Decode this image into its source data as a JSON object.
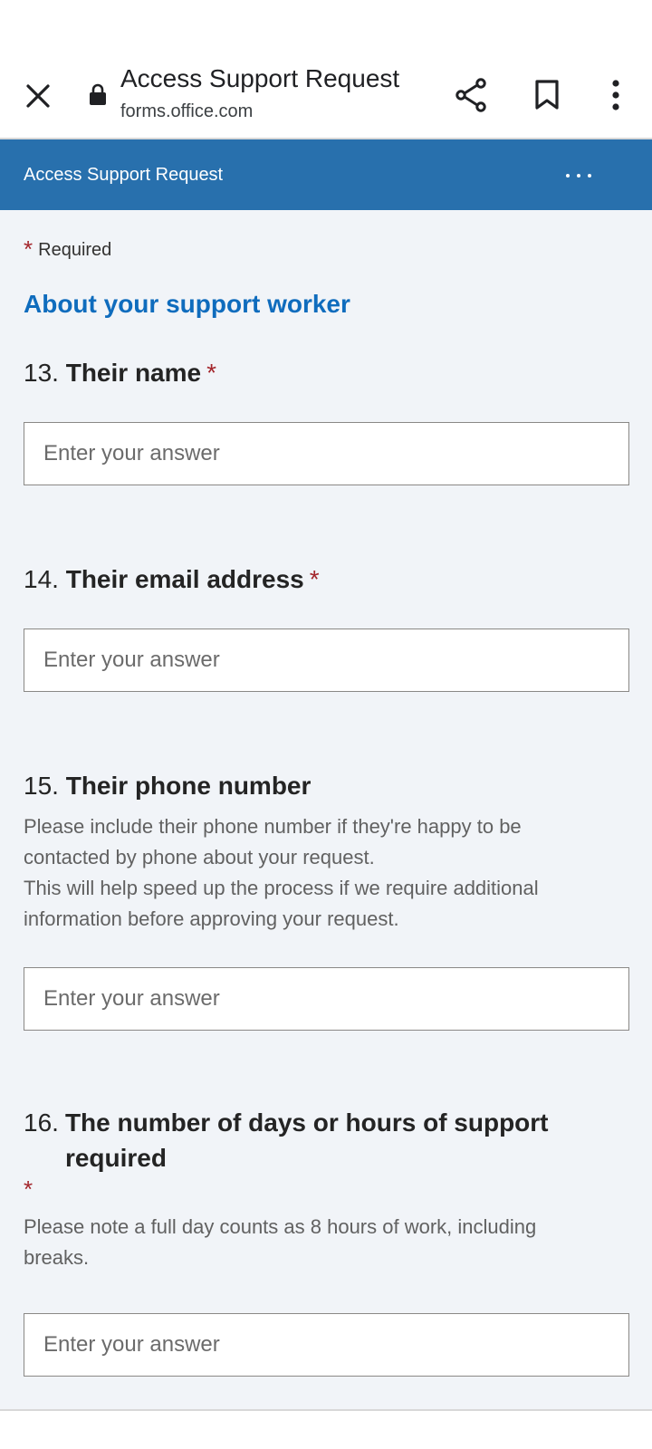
{
  "browser": {
    "page_title": "Access Support Request",
    "domain": "forms.office.com"
  },
  "form": {
    "header_title": "Access Support Request",
    "required_label": "Required",
    "section_title": "About your support worker",
    "placeholder": "Enter your answer",
    "questions": [
      {
        "number": "13.",
        "title": "Their name",
        "required": true,
        "description": ""
      },
      {
        "number": "14.",
        "title": "Their email address",
        "required": true,
        "description": ""
      },
      {
        "number": "15.",
        "title": "Their phone number",
        "required": false,
        "description_lines": [
          "Please include their phone number if they're happy to be",
          "contacted by phone about your request.",
          "This will help speed up the process if we require additional",
          "information before approving your request."
        ]
      },
      {
        "number": "16.",
        "title_lines": [
          "The number of days or hours of support",
          "required"
        ],
        "required": true,
        "description_lines": [
          "Please note a full day counts as 8 hours of work, including",
          "breaks."
        ]
      }
    ],
    "required_mark": "*"
  },
  "colors": {
    "header_bg": "#2870ad",
    "section_title": "#0f6cbd",
    "required_star": "#a4262c",
    "form_bg": "#f1f4f8"
  },
  "icons": [
    "close-icon",
    "lock-icon",
    "share-icon",
    "bookmark-icon",
    "more-vert-icon",
    "more-horiz-icon"
  ]
}
